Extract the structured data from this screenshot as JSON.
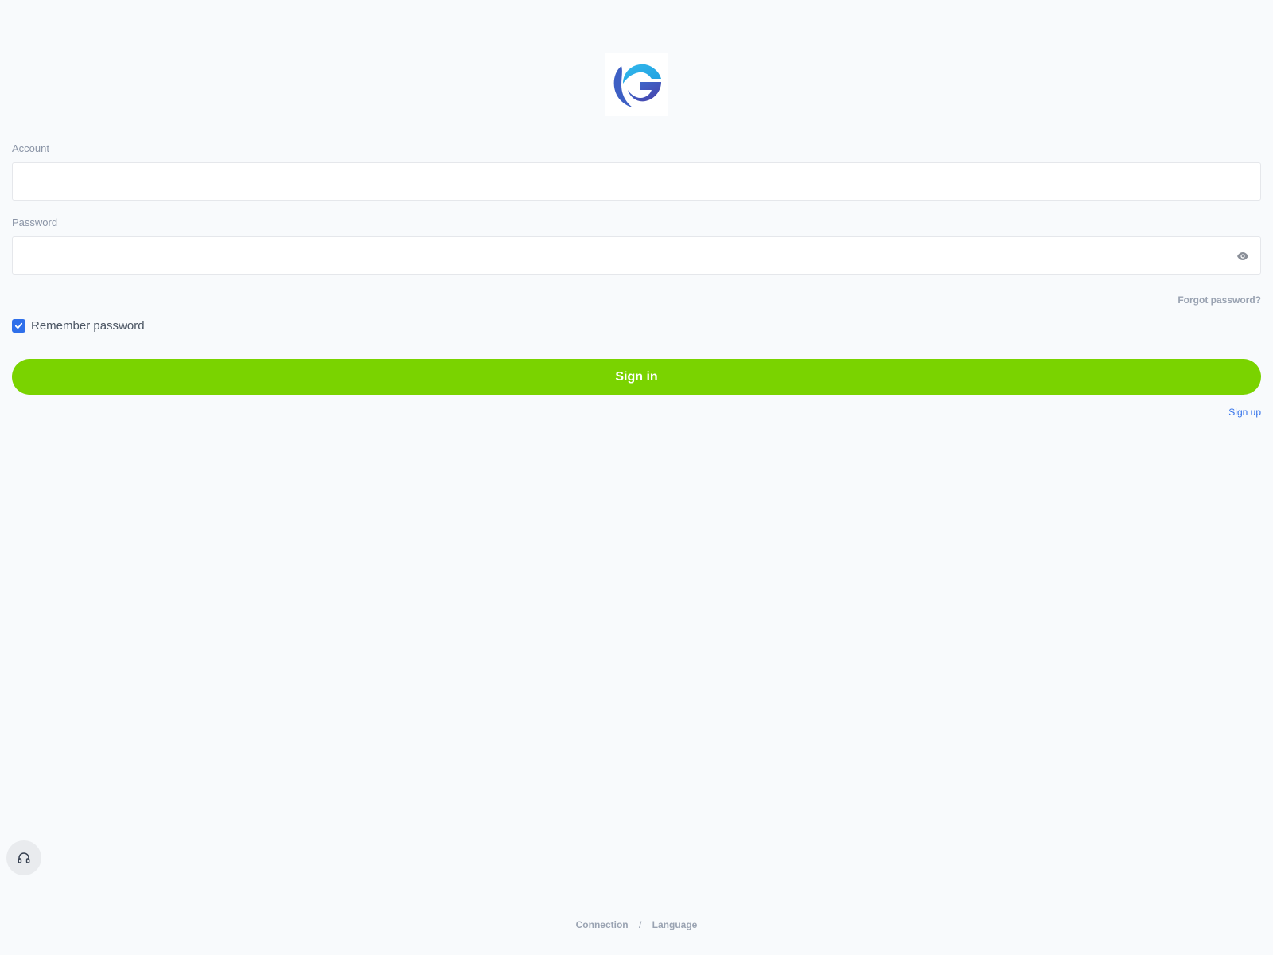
{
  "form": {
    "account_label": "Account",
    "account_value": "",
    "password_label": "Password",
    "password_value": "",
    "forgot_password": "Forgot password?",
    "remember_password": "Remember password",
    "remember_checked": true,
    "sign_in": "Sign in",
    "sign_up": "Sign up"
  },
  "footer": {
    "connection": "Connection",
    "separator": "/",
    "language": "Language"
  },
  "icons": {
    "logo": "brand-g-logo",
    "password_toggle": "eye-icon",
    "checkbox": "check-icon",
    "support": "headphones-icon"
  },
  "colors": {
    "primary_button": "#7ad300",
    "accent": "#2f6fea",
    "background": "#f8fafc"
  }
}
